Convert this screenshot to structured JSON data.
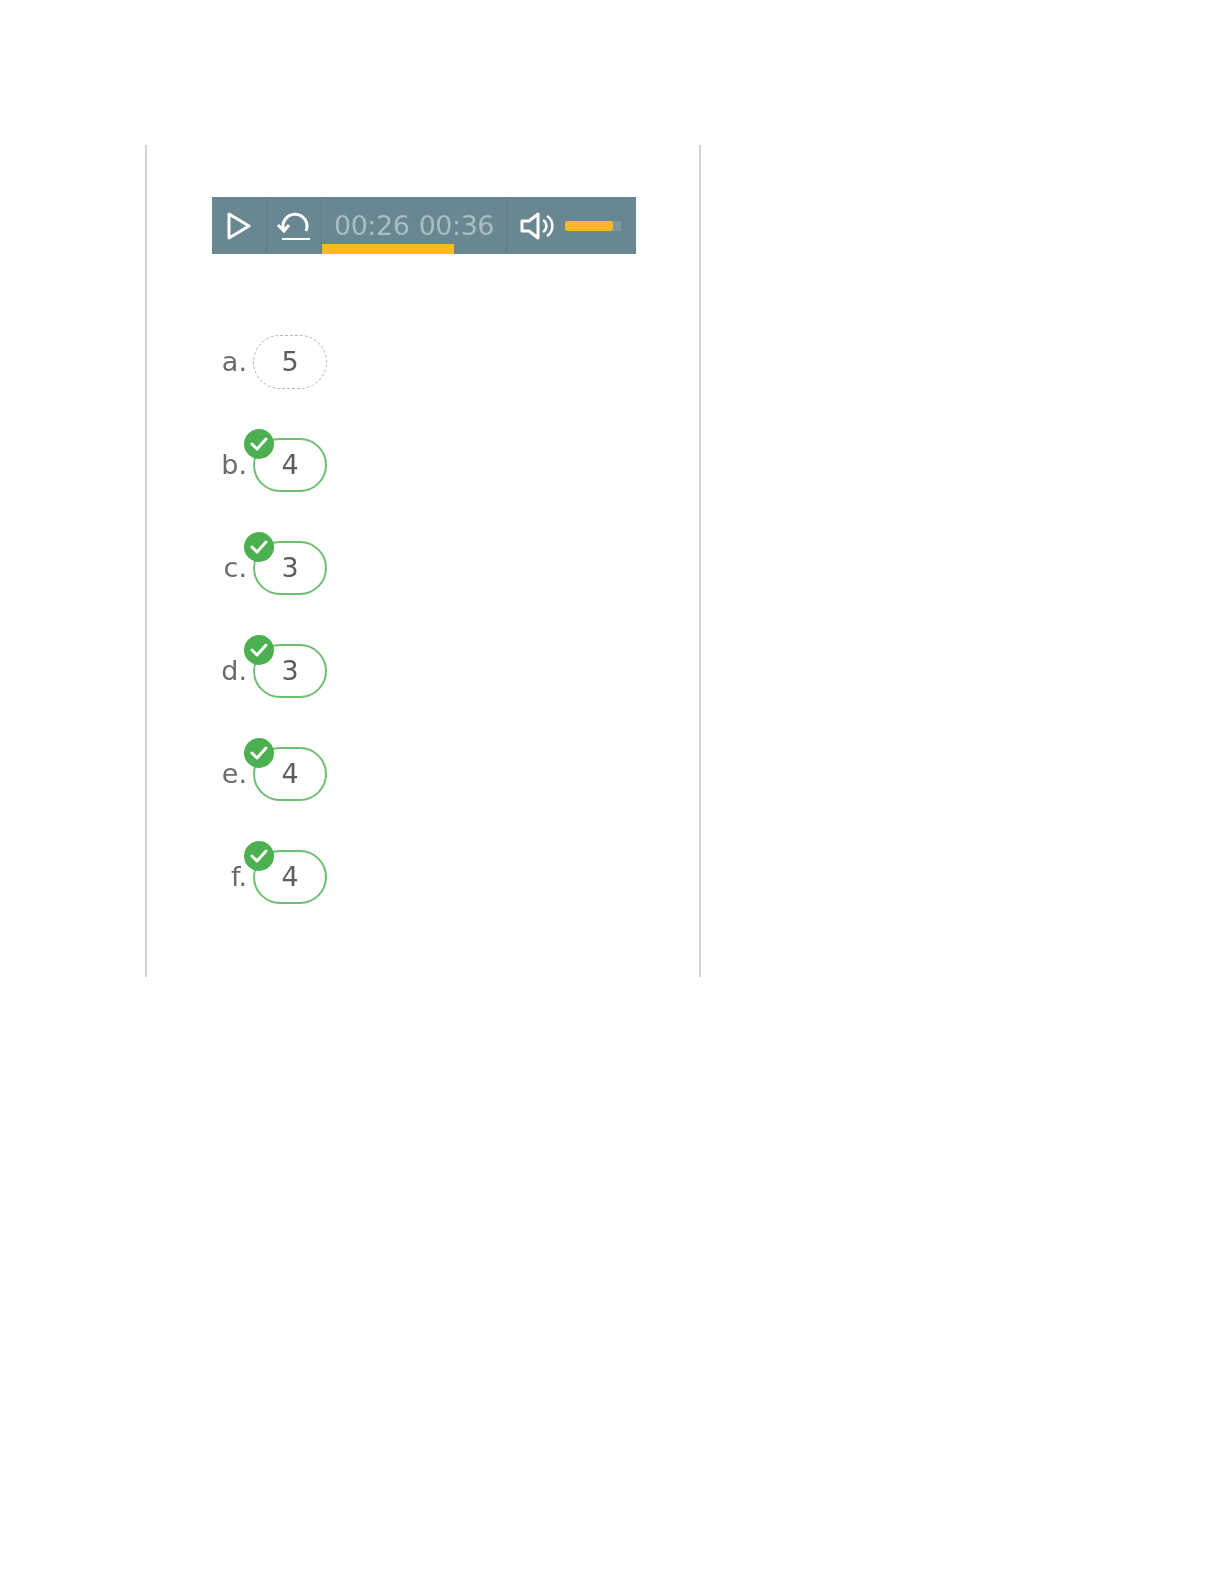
{
  "player": {
    "current_time": "00:26",
    "total_time": "00:36",
    "progress": {
      "level": 0.72
    },
    "volume": {
      "level": 0.85
    }
  },
  "answers": [
    {
      "label": "a.",
      "value": "5",
      "correct": false
    },
    {
      "label": "b.",
      "value": "4",
      "correct": true
    },
    {
      "label": "c.",
      "value": "3",
      "correct": true
    },
    {
      "label": "d.",
      "value": "3",
      "correct": true
    },
    {
      "label": "e.",
      "value": "4",
      "correct": true
    },
    {
      "label": "f.",
      "value": "4",
      "correct": true
    }
  ]
}
